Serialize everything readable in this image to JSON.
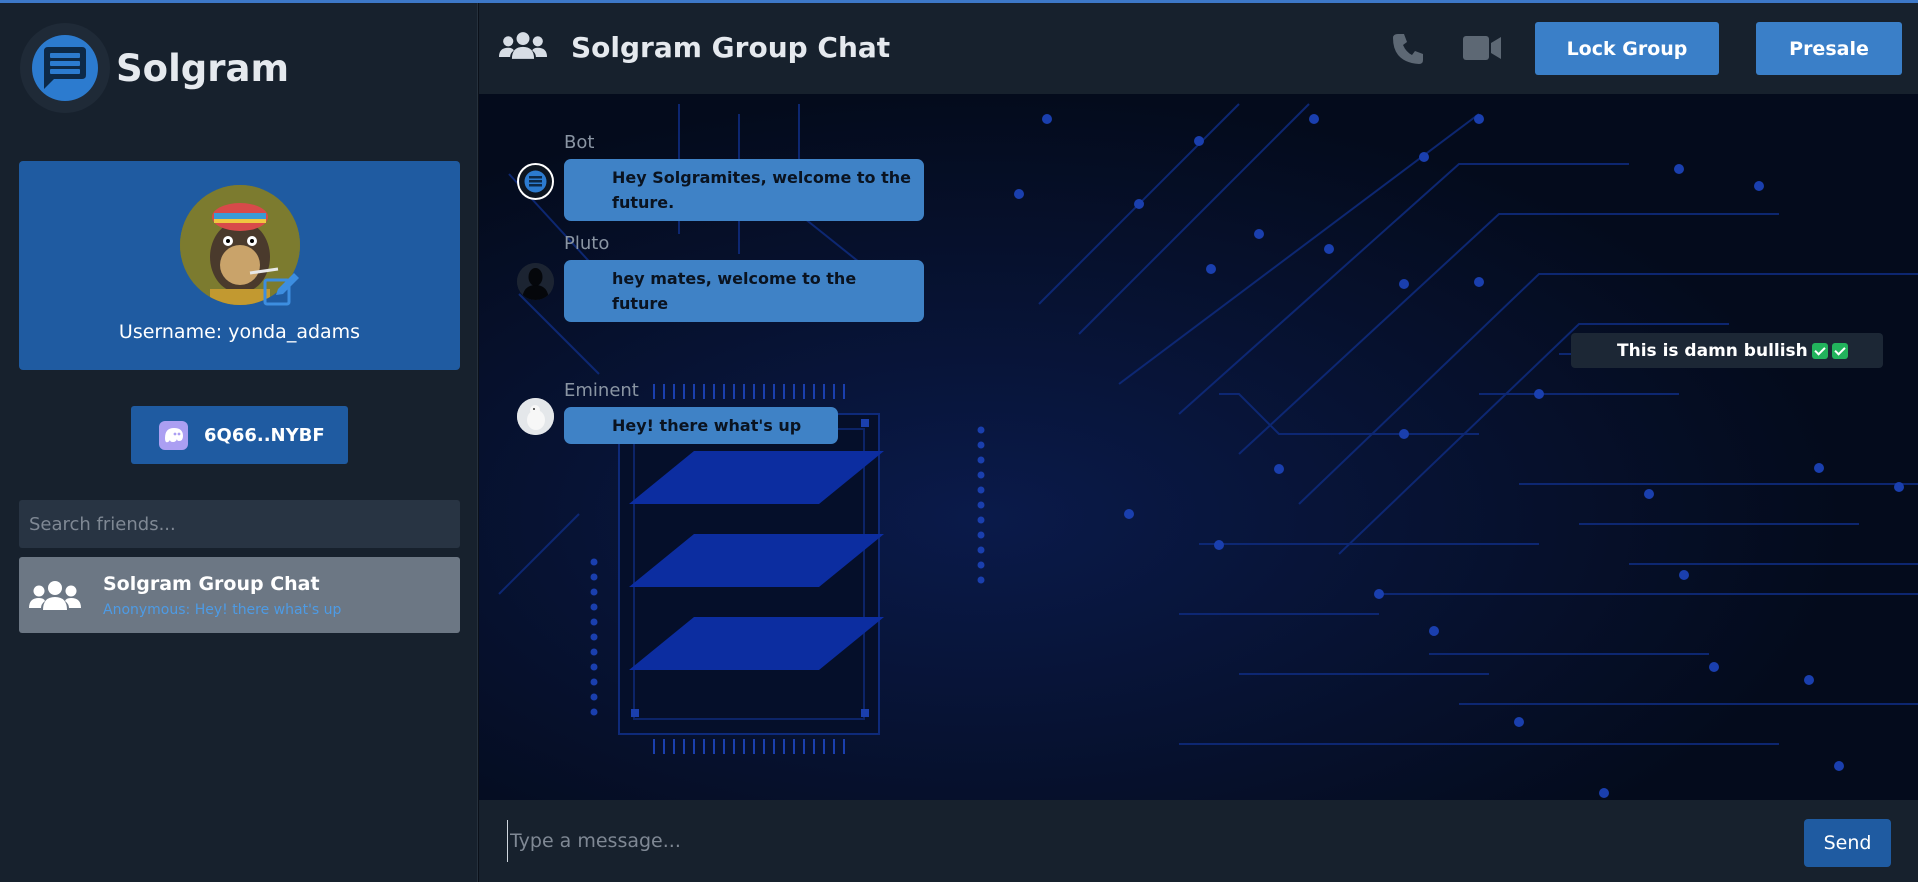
{
  "app": {
    "name": "Solgram"
  },
  "profile": {
    "username_label": "Username: yonda_adams"
  },
  "wallet": {
    "address": "6Q66..NYBF"
  },
  "search": {
    "placeholder": "Search friends..."
  },
  "chat_list": [
    {
      "title": "Solgram Group Chat",
      "preview": "Anonymous: Hey! there what's up"
    }
  ],
  "header": {
    "title": "Solgram Group Chat",
    "lock_label": "Lock Group",
    "presale_label": "Presale"
  },
  "messages": [
    {
      "sender": "Bot",
      "text": "Hey Solgramites, welcome to the future.",
      "avatar": "solgram-logo"
    },
    {
      "sender": "Pluto",
      "text": "hey mates, welcome to the future",
      "avatar": "silhouette"
    },
    {
      "sender": "Eminent",
      "text": "Hey! there what's up",
      "avatar": "bird"
    }
  ],
  "own_message": {
    "text": "This is damn bullish"
  },
  "composer": {
    "placeholder": "Type a message...",
    "send_label": "Send"
  },
  "colors": {
    "accent": "#3a7fc8",
    "card": "#1f5ba1",
    "sidebar": "#17212d",
    "chat_bg": "#040b1c",
    "check": "#22b35c"
  }
}
